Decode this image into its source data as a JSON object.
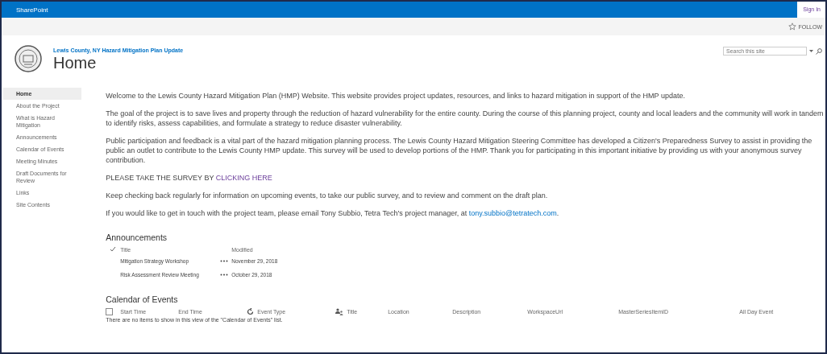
{
  "suite_bar": {
    "brand": "SharePoint",
    "sign_in": "Sign In"
  },
  "ribbon": {
    "follow": "FOLLOW"
  },
  "header": {
    "site_title": "Lewis County, NY Hazard Mitigation Plan Update",
    "page_title": "Home",
    "search": {
      "placeholder": "Search this site"
    }
  },
  "nav": [
    {
      "label": "Home",
      "selected": true
    },
    {
      "label": "About the Project",
      "selected": false
    },
    {
      "label": "What is Hazard Mitigation",
      "selected": false
    },
    {
      "label": "Announcements",
      "selected": false
    },
    {
      "label": "Calendar of Events",
      "selected": false
    },
    {
      "label": "Meeting Minutes",
      "selected": false
    },
    {
      "label": "Draft Documents for Review",
      "selected": false
    },
    {
      "label": "Links",
      "selected": false
    },
    {
      "label": "Site Contents",
      "selected": false
    }
  ],
  "paragraphs": [
    "Welcome to the Lewis County Hazard Mitigation Plan (HMP) Website.  This website provides project updates, resources, and links to hazard mitigation in support of the HMP update.",
    "The goal of the project is to save lives and property through the reduction of hazard vulnerability for the entire county.  During the course of this planning project, county and local leaders and the community will work in tandem to identify risks, assess capabilities, and formulate a strategy to reduce disaster vulnerability.",
    "Public participation and feedback is a vital part of the hazard mitigation planning process. The Lewis County Hazard Mitigation Steering Committee has developed a Citizen's Preparedness Survey to assist in providing the public an outlet to contribute to the Lewis County HMP update. This survey will be used to develop portions of the HMP. Thank you for participating in this important initiative by providing us with your anonymous survey contribution."
  ],
  "survey": {
    "text": "PLEASE TAKE THE SURVEY BY",
    "link": "CLICKING HERE"
  },
  "keep_checking": "Keep checking back regularly for information on upcoming events, to take our public survey, and to review and comment on the draft plan.",
  "contact": {
    "text": "If you would like to get in touch with the project team, please email Tony Subbio, Tetra Tech's project manager, at",
    "email": "tony.subbio@tetratech.com",
    "end": "."
  },
  "announcements": {
    "title": "Announcements",
    "columns": [
      "Title",
      "Modified"
    ],
    "rows": [
      {
        "title": "Mitigation Strategy Workshop",
        "modified": "November 29, 2018"
      },
      {
        "title": "Risk Assessment Review Meeting",
        "modified": "October 29, 2018"
      }
    ]
  },
  "calendar": {
    "title": "Calendar of Events",
    "select_all_checked": false,
    "columns": [
      {
        "label": "Start Time",
        "kind": "checkbox"
      },
      {
        "label": "End Time",
        "kind": "plain"
      },
      {
        "label": "Event Type",
        "kind": "recurrence"
      },
      {
        "label": "Title",
        "kind": "attendee"
      },
      {
        "label": "Location",
        "kind": "plain"
      },
      {
        "label": "Description",
        "kind": "plain"
      },
      {
        "label": "WorkspaceUrl",
        "kind": "plain"
      },
      {
        "label": "MasterSeriesItemID",
        "kind": "plain"
      },
      {
        "label": "All Day Event",
        "kind": "plain"
      }
    ],
    "empty": "There are no items to show in this view of the \"Calendar of Events\" list."
  }
}
